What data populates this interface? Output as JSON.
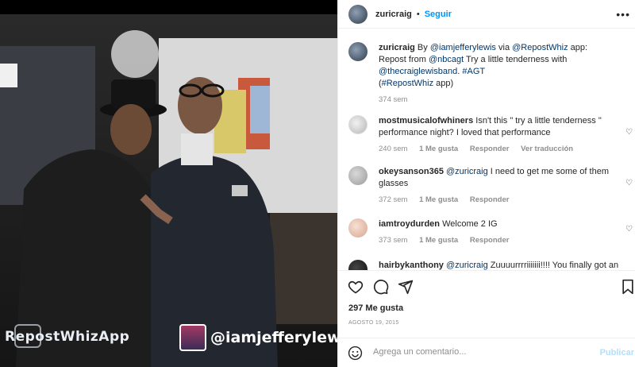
{
  "header": {
    "username": "zuricraig",
    "dot": "•",
    "follow_label": "Seguir",
    "more_icon": "more-horizontal-icon"
  },
  "photo": {
    "watermark_left": "RepostWhizApp",
    "watermark_handle": "@iamjefferylewis"
  },
  "caption": {
    "username": "zuricraig",
    "text_parts": [
      "By ",
      "@iamjefferylewis",
      " via ",
      "@RepostWhiz",
      " app: Repost from ",
      "@nbcagt",
      " Try a little tenderness with ",
      "@thecraiglewisband",
      ". ",
      "#AGT",
      " (",
      "#RepostWhiz",
      " app)"
    ],
    "time": "374 sem"
  },
  "comments": [
    {
      "username": "mostmusicalofwhiners",
      "text": "Isn't this \" try a little tenderness \" performance night? I loved that performance",
      "time": "240 sem",
      "likes": "1 Me gusta",
      "reply": "Responder",
      "translate": "Ver traducción"
    },
    {
      "username": "okeysanson365",
      "mention": "@zuricraig",
      "text": " I need to get me some of them glasses",
      "time": "372 sem",
      "likes": "1 Me gusta",
      "reply": "Responder"
    },
    {
      "username": "iamtroydurden",
      "text": "Welcome 2 IG",
      "time": "373 sem",
      "likes": "1 Me gusta",
      "reply": "Responder"
    },
    {
      "username": "hairbykanthony",
      "mention": "@zuricraig",
      "text": " Zuuuurrrriiiiiii!!!! You finally got an"
    }
  ],
  "actions": {
    "like_icon": "heart-icon",
    "comment_icon": "comment-icon",
    "share_icon": "share-icon",
    "save_icon": "bookmark-icon"
  },
  "likes_text": "297 Me gusta",
  "date_text": "AGOSTO 19, 2015",
  "add_comment": {
    "placeholder": "Agrega un comentario...",
    "publish_label": "Publicar",
    "emoji_icon": "emoji-icon"
  },
  "colors": {
    "accent": "#0095f6",
    "link": "#00376b",
    "muted": "#8e8e8e",
    "publish_disabled": "#b2dffc"
  }
}
